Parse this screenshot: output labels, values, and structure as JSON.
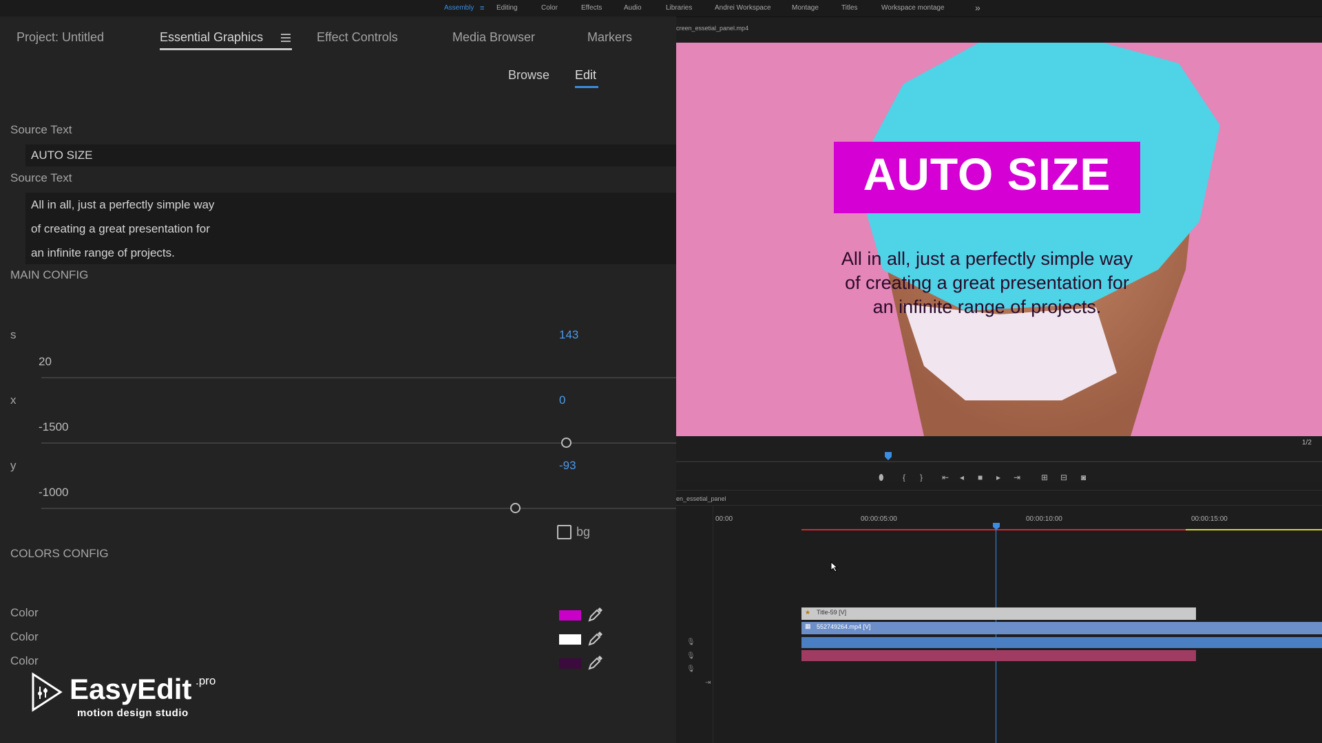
{
  "workspaces": {
    "items": [
      "Assembly",
      "Editing",
      "Color",
      "Effects",
      "Audio",
      "Libraries",
      "Andrei Workspace",
      "Montage",
      "Titles",
      "Workspace montage"
    ],
    "more": "»"
  },
  "panel": {
    "tabs": [
      "Project: Untitled",
      "Essential Graphics",
      "Effect Controls",
      "Media Browser",
      "Markers"
    ],
    "active_tab": "Essential Graphics",
    "subtabs": {
      "browse": "Browse",
      "edit": "Edit"
    }
  },
  "source_text_1": {
    "label": "Source Text",
    "value": "AUTO SIZE"
  },
  "source_text_2": {
    "label": "Source Text",
    "lines": [
      "All in all, just a perfectly simple way",
      "of creating a great presentation for",
      "an infinite range of projects."
    ]
  },
  "main_config": {
    "label": "MAIN CONFIG",
    "s": {
      "label": "s",
      "value": "143",
      "min": "20",
      "level": 0.95
    },
    "x": {
      "label": "x",
      "value": "0",
      "min": "-1500",
      "level": 0.5
    },
    "y": {
      "label": "y",
      "value": "-93",
      "min": "-1000",
      "level": 0.45
    },
    "bg": {
      "label": "bg",
      "checked": false
    }
  },
  "colors_config": {
    "label": "COLORS CONFIG",
    "items": [
      {
        "label": "Color",
        "color": "#c800c8"
      },
      {
        "label": "Color",
        "color": "#ffffff"
      },
      {
        "label": "Color",
        "color": "#3c0a3c"
      }
    ]
  },
  "brand": {
    "name": "EasyEdit",
    "suffix": ".pro",
    "tagline": "motion design studio"
  },
  "viewer": {
    "filename": "creen_essetial_panel.mp4",
    "title": "AUTO SIZE",
    "body_lines": [
      "All in all, just a perfectly simple way",
      "of creating a great presentation for",
      "an infinite range of projects."
    ],
    "title_bg": "#d400d4",
    "bg": "#e486b7",
    "page": "1/2"
  },
  "timeline": {
    "sequence": "en_essetial_panel",
    "times": [
      "00:00",
      "00:00:05:00",
      "00:00:10:00",
      "00:00:15:00"
    ],
    "clips": {
      "title": "Title-59 [V]",
      "video": "552749264.mp4 [V]"
    }
  }
}
